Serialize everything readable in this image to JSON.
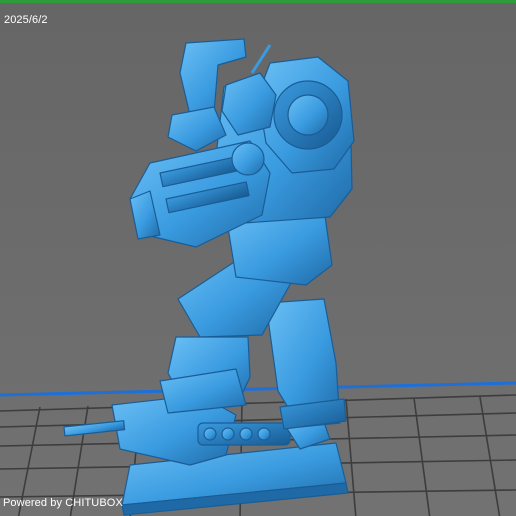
{
  "viewer": {
    "date_text": "2025/6/2",
    "watermark_text": "Powered by CHITUBOX"
  },
  "scene": {
    "background_color": "#6b6b6b",
    "grid_color": "#3a3a3a",
    "platform_edge_color": "#1e6fd8",
    "model_color": "#3a9be0",
    "model_highlight_color": "#6cc0f5",
    "model_shadow_color": "#1f6aa6",
    "model_subject": "mech-robot-miniature"
  }
}
